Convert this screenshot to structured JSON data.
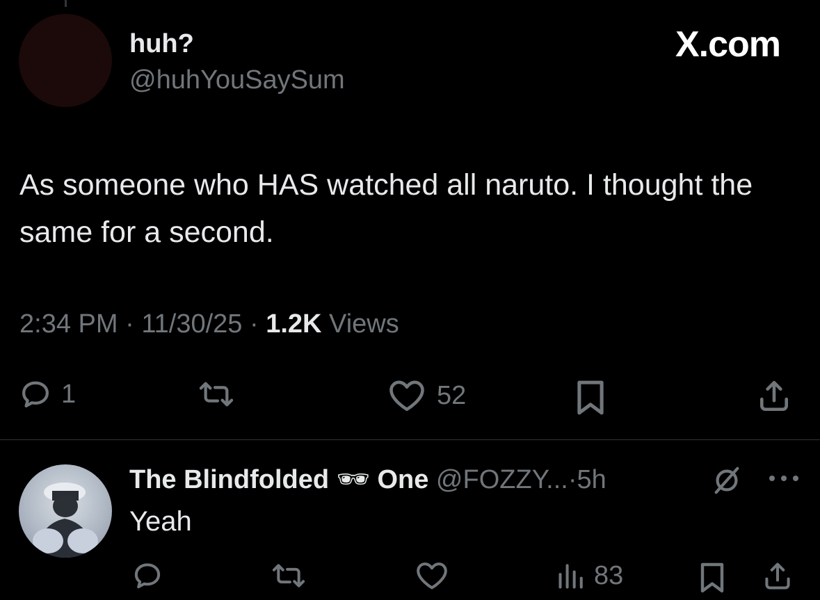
{
  "watermark": "X.com",
  "post": {
    "display_name": "huh?",
    "handle": "@huhYouSaySum",
    "text": "As someone who HAS watched all naruto. I thought the same for a second.",
    "time": "2:34 PM",
    "date": "11/30/25",
    "views_count": "1.2K",
    "views_label": "Views",
    "sep": "·",
    "actions": {
      "reply_icon": "reply-icon",
      "reply_count": "1",
      "repost_icon": "repost-icon",
      "like_icon": "heart-icon",
      "like_count": "52",
      "bookmark_icon": "bookmark-icon",
      "share_icon": "share-icon"
    }
  },
  "reply": {
    "name_part1": "The Blindfolded",
    "emoji": "🕶",
    "name_part2": "One",
    "handle": "@FOZZY...",
    "age": "5h",
    "sep": "·",
    "text": "Yeah",
    "actions": {
      "views_count": "83"
    }
  }
}
